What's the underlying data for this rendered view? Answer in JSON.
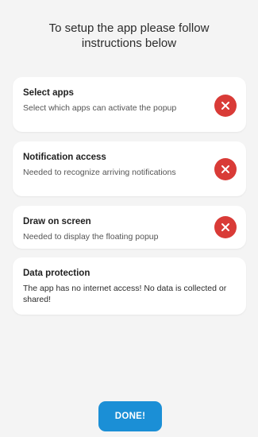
{
  "header": {
    "line1": "To setup the app please follow",
    "line2": "instructions below"
  },
  "cards": [
    {
      "title": "Select apps",
      "description": "Select which apps can activate the popup",
      "status_icon": "close-icon"
    },
    {
      "title": "Notification access",
      "description": "Needed to recognize arriving notifications",
      "status_icon": "close-icon"
    },
    {
      "title": "Draw on screen",
      "description": "Needed to display the floating popup",
      "status_icon": "close-icon"
    },
    {
      "title": "Data protection",
      "description": "The app has no internet access! No data is collected or shared!"
    }
  ],
  "done_button": {
    "label": "DONE!"
  },
  "colors": {
    "background": "#f4f4f4",
    "card": "#ffffff",
    "status_red": "#d93b37",
    "primary_blue": "#1b8fd6"
  }
}
